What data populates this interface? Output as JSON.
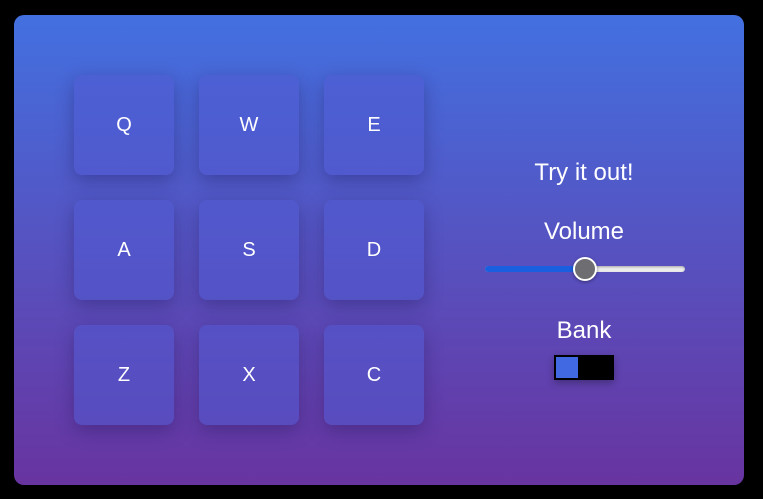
{
  "pads": [
    {
      "key": "Q"
    },
    {
      "key": "W"
    },
    {
      "key": "E"
    },
    {
      "key": "A"
    },
    {
      "key": "S"
    },
    {
      "key": "D"
    },
    {
      "key": "Z"
    },
    {
      "key": "X"
    },
    {
      "key": "C"
    }
  ],
  "controls": {
    "display_text": "Try it out!",
    "volume_label": "Volume",
    "volume_value": 0.5,
    "bank_label": "Bank",
    "bank_on": false
  },
  "colors": {
    "gradient_top": "#4370e0",
    "gradient_bottom": "#6834a0",
    "slider_fill": "#1a5fe0",
    "toggle_knob": "#4169e1"
  }
}
